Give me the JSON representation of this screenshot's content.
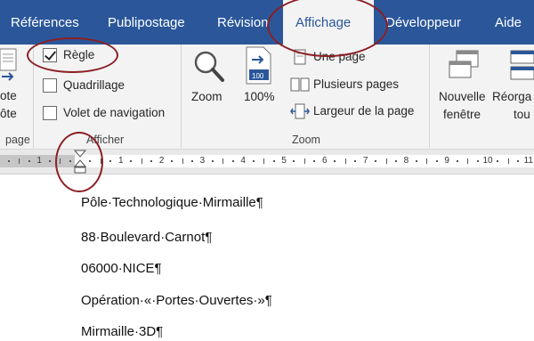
{
  "tabs": [
    {
      "label": "Références"
    },
    {
      "label": "Publipostage"
    },
    {
      "label": "Révision"
    },
    {
      "label": "Affichage"
    },
    {
      "label": "Développeur"
    },
    {
      "label": "Aide"
    }
  ],
  "ribbon": {
    "views_group": {
      "item_label_line1": "ote",
      "item_label_line2": "ôte",
      "group_label": "page"
    },
    "show_group": {
      "ruler": {
        "label": "Règle",
        "checked": true
      },
      "gridlines": {
        "label": "Quadrillage",
        "checked": false
      },
      "navigation_pane": {
        "label": "Volet de navigation",
        "checked": false
      },
      "group_label": "Afficher"
    },
    "zoom_group": {
      "zoom_label": "Zoom",
      "zoom100_label": "100%",
      "zoom100_icon_text": "100",
      "one_page": "Une page",
      "multiple_pages": "Plusieurs pages",
      "page_width": "Largeur de la page",
      "group_label": "Zoom"
    },
    "window_group": {
      "new_window_line1": "Nouvelle",
      "new_window_line2": "fenêtre",
      "arrange_line1": "Réorga",
      "arrange_line2": "tou"
    }
  },
  "ruler": {
    "left_numbers": [
      "1"
    ],
    "right_numbers": [
      "1",
      "2",
      "3",
      "4",
      "5",
      "6",
      "7",
      "8",
      "9",
      "10",
      "11"
    ]
  },
  "document": {
    "paragraphs": [
      "Pôle·Technologique·Mirmaille¶",
      "88·Boulevard·Carnot¶",
      "06000·NICE¶",
      "Opération·«·Portes·Ouvertes·»¶",
      "Mirmaille·3D¶"
    ]
  },
  "colors": {
    "ribbon_blue": "#2b579a",
    "ribbon_bg": "#f3f3f3",
    "annotation_circle": "#8b1f24"
  }
}
